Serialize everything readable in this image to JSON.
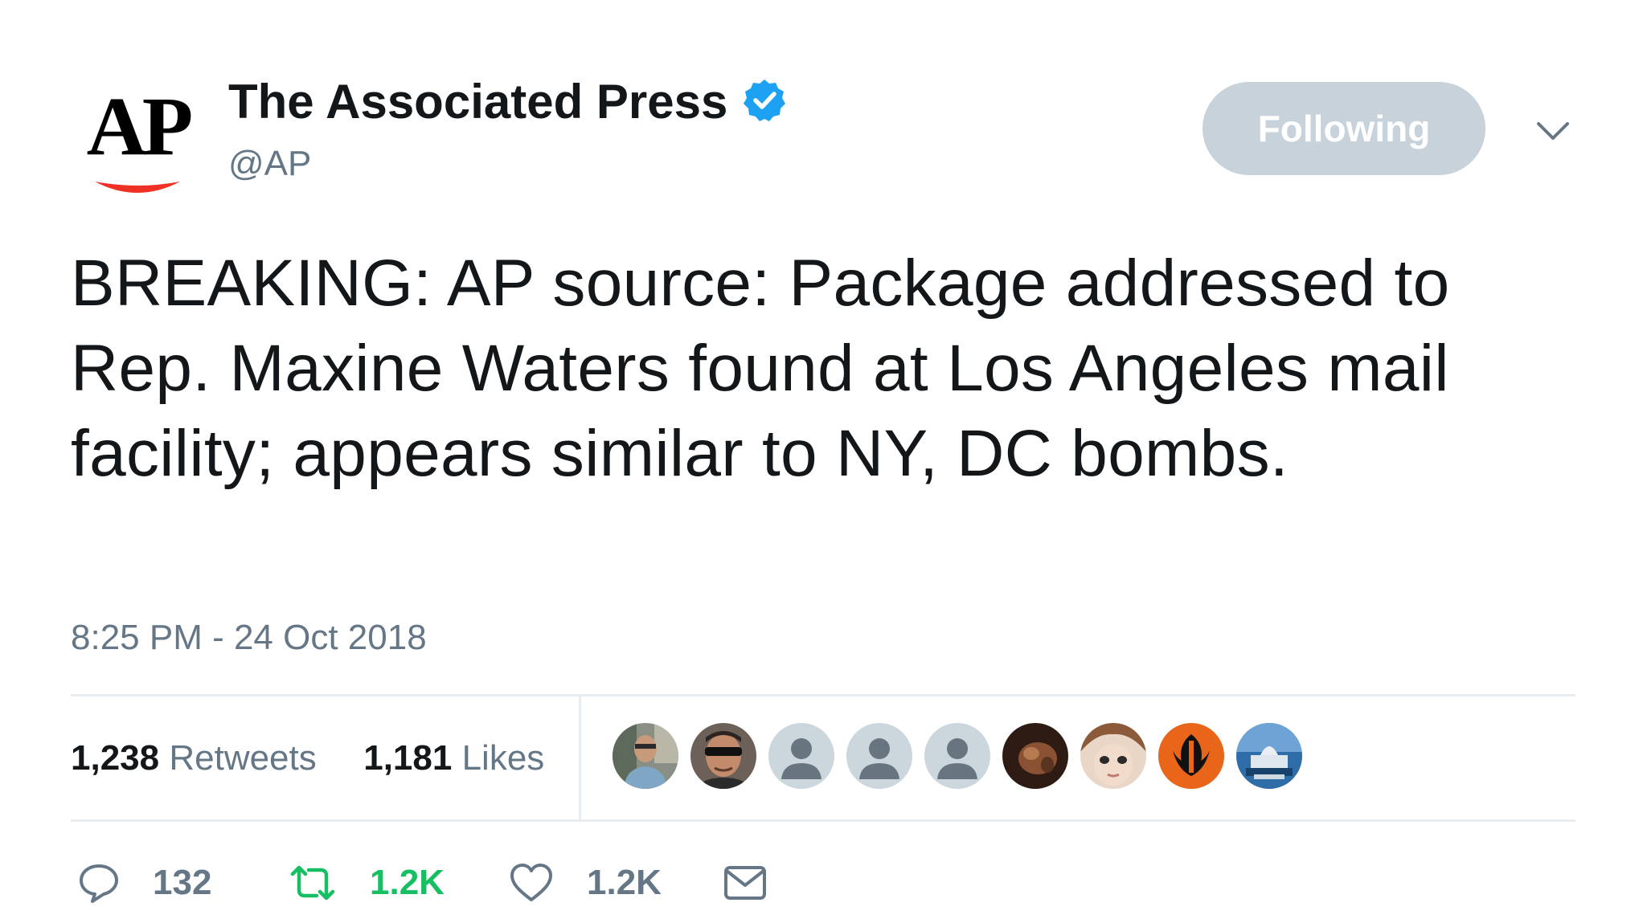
{
  "header": {
    "logo_text": "AP",
    "display_name": "The Associated Press",
    "handle": "@AP",
    "verified": true,
    "follow_button_label": "Following",
    "menu_icon": "chevron-down-icon"
  },
  "tweet": {
    "text": "BREAKING: AP source: Package addressed to Rep. Maxine Waters found at Los Angeles mail facility; appears similar to NY, DC bombs.",
    "timestamp": "8:25 PM - 24 Oct 2018"
  },
  "stats": {
    "retweets_count": "1,238",
    "retweets_label": "Retweets",
    "likes_count": "1,181",
    "likes_label": "Likes"
  },
  "likers": [
    {
      "kind": "photo-person"
    },
    {
      "kind": "photo-sunglasses"
    },
    {
      "kind": "default-silhouette"
    },
    {
      "kind": "default-silhouette"
    },
    {
      "kind": "default-silhouette"
    },
    {
      "kind": "photo-dark"
    },
    {
      "kind": "photo-face"
    },
    {
      "kind": "rebel-emblem"
    },
    {
      "kind": "photo-capitol"
    }
  ],
  "actions": {
    "reply_count": "132",
    "retweet_count": "1.2K",
    "like_count": "1.2K",
    "reply_icon": "reply-icon",
    "retweet_icon": "retweet-icon",
    "like_icon": "heart-icon",
    "dm_icon": "envelope-icon"
  },
  "colors": {
    "text": "#14171a",
    "secondary": "#657786",
    "verified": "#1da1f2",
    "retweet_active": "#17bf63",
    "follow_button_bg": "#c7d2da",
    "ap_red": "#ee3124",
    "divider": "#e6ecf0"
  }
}
